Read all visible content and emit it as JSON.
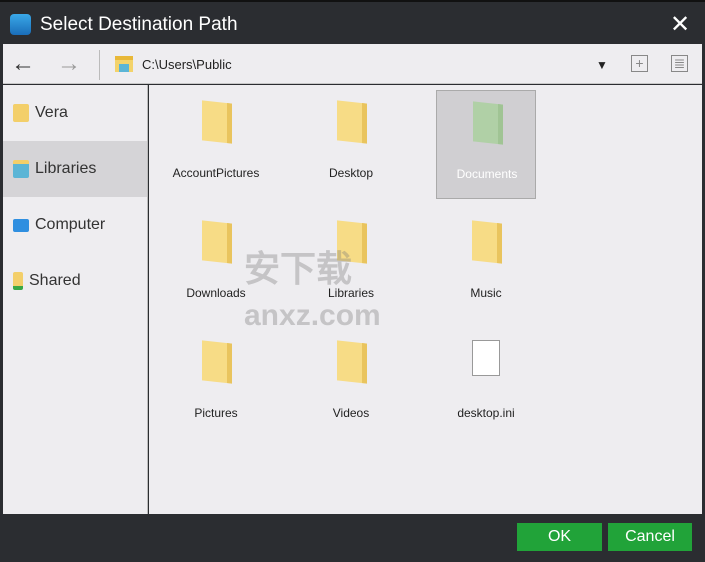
{
  "window": {
    "title": "Select Destination Path",
    "close": "✕"
  },
  "toolbar": {
    "back": "←",
    "forward": "→",
    "path": "C:\\Users\\Public",
    "dropdown": "▼",
    "new_folder": "+",
    "view": "≣"
  },
  "sidebar": {
    "items": [
      {
        "label": "Vera",
        "icon": "user-folder-icon",
        "active": false
      },
      {
        "label": "Libraries",
        "icon": "libraries-icon",
        "active": true
      },
      {
        "label": "Computer",
        "icon": "computer-icon",
        "active": false
      },
      {
        "label": "Shared",
        "icon": "shared-icon",
        "active": false
      }
    ]
  },
  "files": [
    {
      "name": "AccountPictures",
      "type": "folder"
    },
    {
      "name": "Desktop",
      "type": "folder"
    },
    {
      "name": "Documents",
      "type": "folder",
      "selected": true
    },
    {
      "name": "Downloads",
      "type": "folder"
    },
    {
      "name": "Libraries",
      "type": "folder"
    },
    {
      "name": "Music",
      "type": "folder"
    },
    {
      "name": "Pictures",
      "type": "folder"
    },
    {
      "name": "Videos",
      "type": "folder"
    },
    {
      "name": "desktop.ini",
      "type": "file"
    }
  ],
  "watermark": "安下载 anxz.com",
  "footer": {
    "ok": "OK",
    "cancel": "Cancel"
  },
  "colors": {
    "accent": "#21a339",
    "titlebar": "#2b2d31"
  }
}
